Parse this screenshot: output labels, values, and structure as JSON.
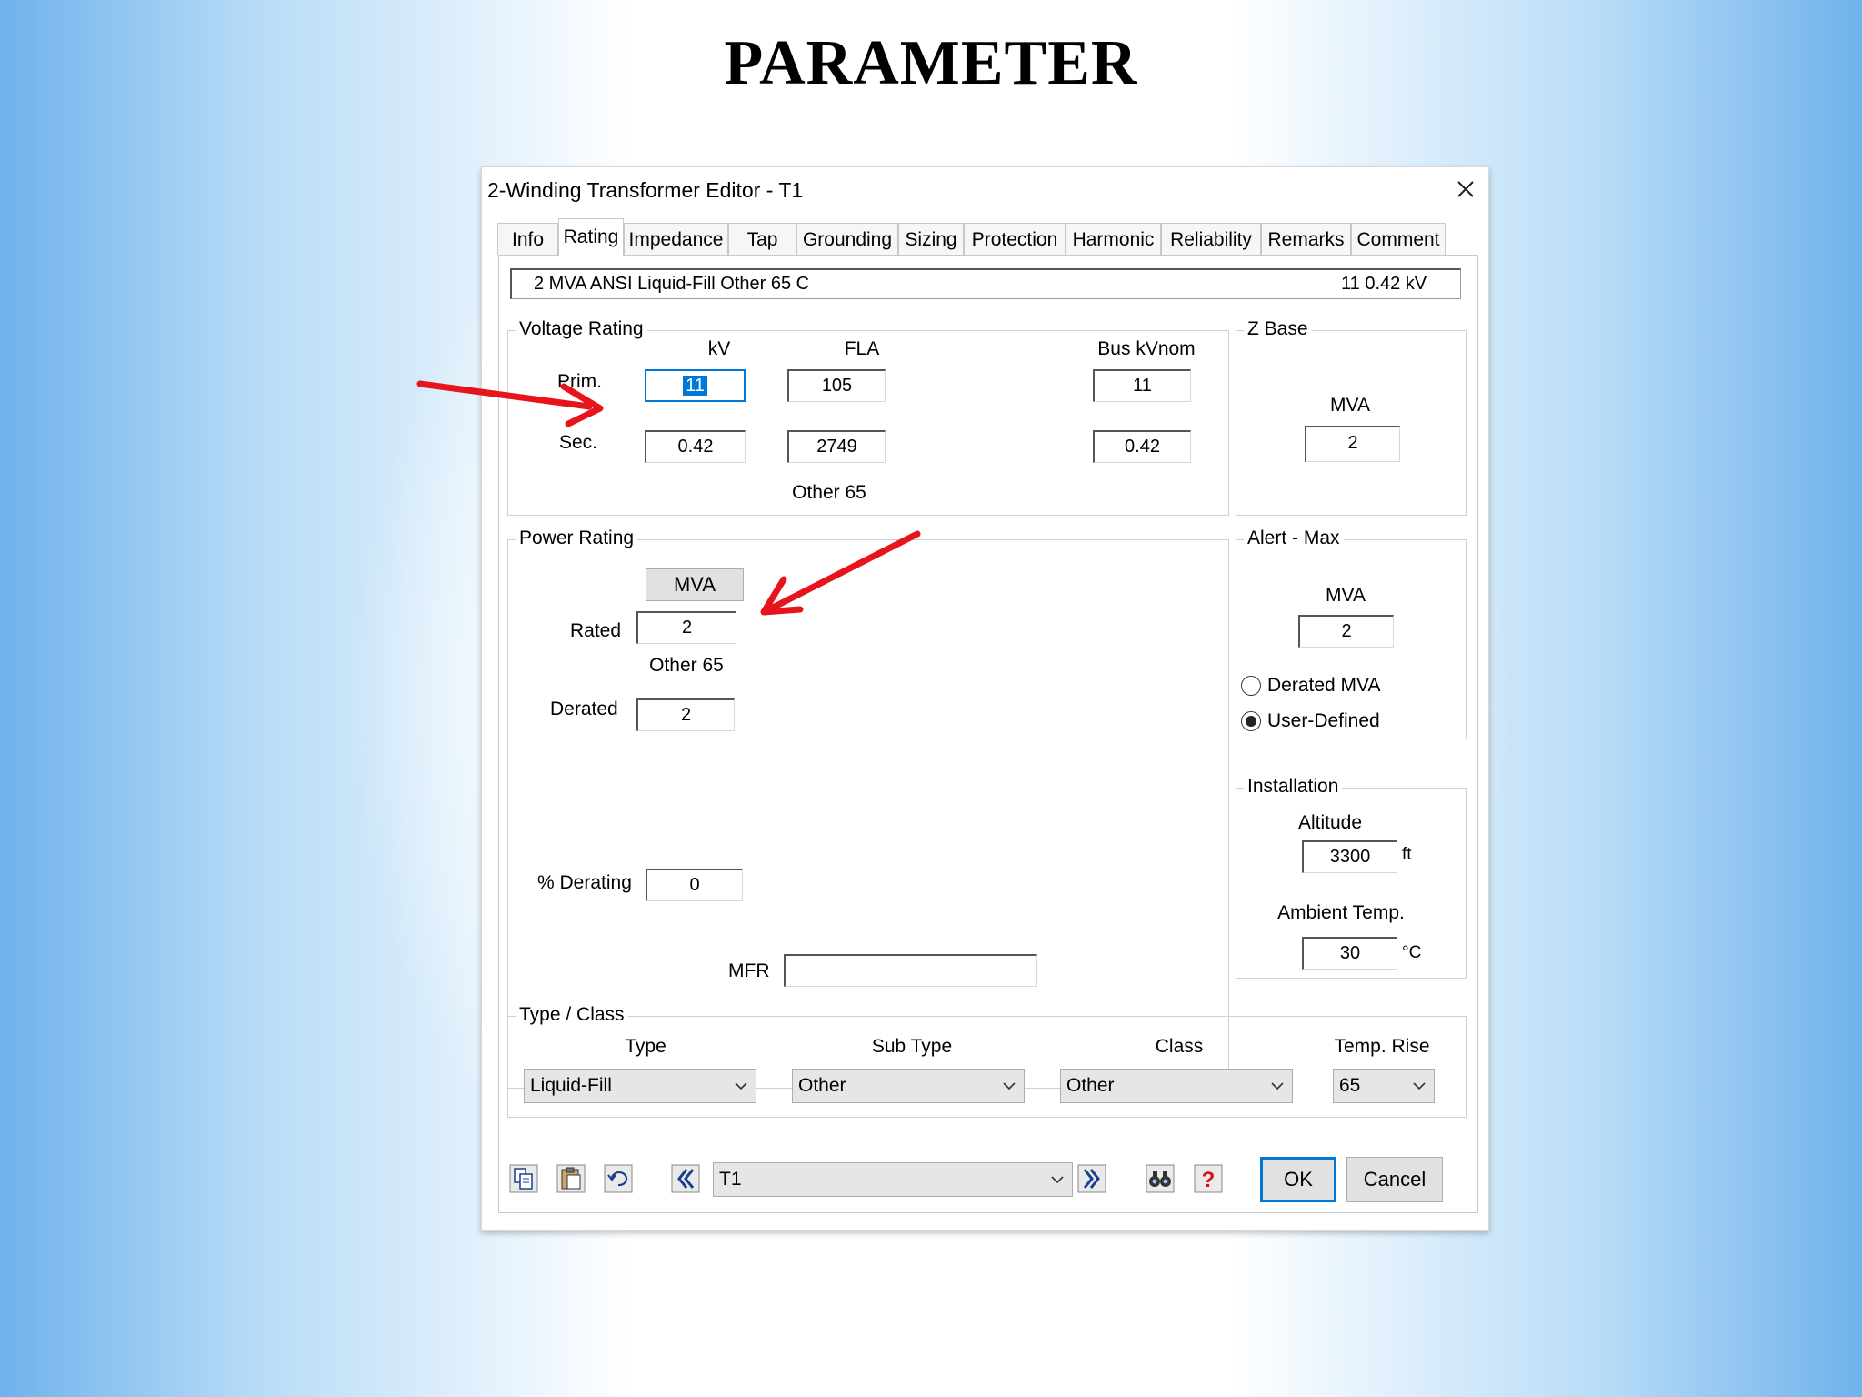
{
  "slide": {
    "title": "PARAMETER"
  },
  "window": {
    "title": "2-Winding Transformer Editor - T1"
  },
  "tabs": [
    {
      "label": "Info"
    },
    {
      "label": "Rating"
    },
    {
      "label": "Impedance"
    },
    {
      "label": "Tap"
    },
    {
      "label": "Grounding"
    },
    {
      "label": "Sizing"
    },
    {
      "label": "Protection"
    },
    {
      "label": "Harmonic"
    },
    {
      "label": "Reliability"
    },
    {
      "label": "Remarks"
    },
    {
      "label": "Comment"
    }
  ],
  "summary": {
    "text": "2 MVA  ANSI  Liquid-Fill  Other  65 C",
    "kv": "11    0.42 kV"
  },
  "voltage_rating": {
    "legend": "Voltage Rating",
    "col_kv": "kV",
    "col_fla": "FLA",
    "col_bus": "Bus kVnom",
    "prim_label": "Prim.",
    "sec_label": "Sec.",
    "prim_kv": "11",
    "prim_fla": "105",
    "prim_bus": "11",
    "sec_kv": "0.42",
    "sec_fla": "2749",
    "sec_bus": "0.42",
    "note": "Other 65"
  },
  "z_base": {
    "legend": "Z Base",
    "unit": "MVA",
    "value": "2"
  },
  "power_rating": {
    "legend": "Power Rating",
    "unit_button": "MVA",
    "rated_label": "Rated",
    "rated_value": "2",
    "note": "Other 65",
    "derated_label": "Derated",
    "derated_value": "2",
    "derating_label": "% Derating",
    "derating_value": "0"
  },
  "alert_max": {
    "legend": "Alert - Max",
    "unit": "MVA",
    "value": "2",
    "option_derated": "Derated MVA",
    "option_user": "User-Defined"
  },
  "installation": {
    "legend": "Installation",
    "altitude_label": "Altitude",
    "altitude_value": "3300",
    "altitude_unit": "ft",
    "ambient_label": "Ambient Temp.",
    "ambient_value": "30",
    "ambient_unit": "°C"
  },
  "mfr": {
    "label": "MFR",
    "value": ""
  },
  "type_class": {
    "legend": "Type / Class",
    "type_label": "Type",
    "type_value": "Liquid-Fill",
    "subtype_label": "Sub Type",
    "subtype_value": "Other",
    "class_label": "Class",
    "class_value": "Other",
    "temp_label": "Temp. Rise",
    "temp_value": "65"
  },
  "footer": {
    "element_value": "T1",
    "ok_label": "OK",
    "cancel_label": "Cancel"
  },
  "colors": {
    "annotation_arrow": "#e8141c",
    "focus": "#0078d7"
  }
}
